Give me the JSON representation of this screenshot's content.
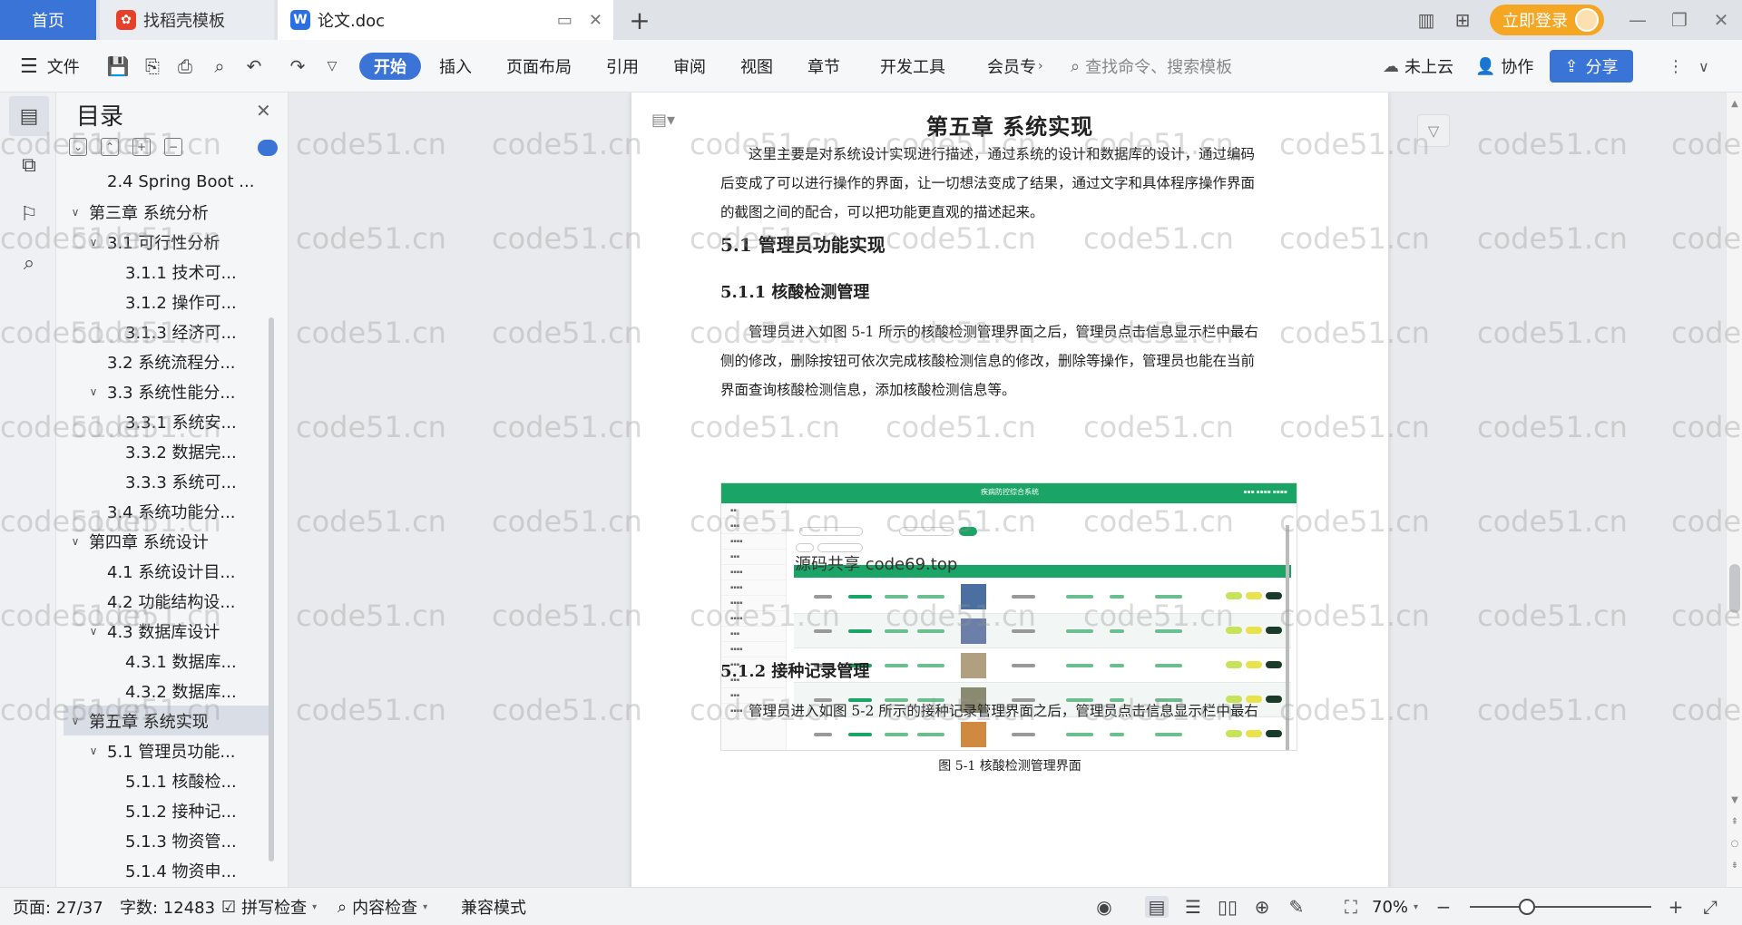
{
  "tabs": {
    "home": "首页",
    "template": "找稻壳模板",
    "document": "论文.doc",
    "add": "+"
  },
  "top_right": {
    "login": "立即登录",
    "window": {
      "minimize": "—",
      "maximize": "❐",
      "close": "✕"
    }
  },
  "toolbar": {
    "file_menu": "文件",
    "tabs": [
      "开始",
      "插入",
      "页面布局",
      "引用",
      "审阅",
      "视图",
      "章节",
      "开发工具",
      "会员专"
    ],
    "search_placeholder": "查找命令、搜索模板",
    "cloud": "未上云",
    "collab": "协作",
    "share": "分享"
  },
  "outline": {
    "title": "目录",
    "items": [
      {
        "label": "2.4 Spring Boot ...",
        "level": 2,
        "arrow": ""
      },
      {
        "label": "第三章  系统分析",
        "level": 1,
        "arrow": "v"
      },
      {
        "label": "3.1 可行性分析",
        "level": 2,
        "arrow": "v"
      },
      {
        "label": "3.1.1 技术可...",
        "level": 3,
        "arrow": ""
      },
      {
        "label": "3.1.2 操作可...",
        "level": 3,
        "arrow": ""
      },
      {
        "label": "3.1.3 经济可...",
        "level": 3,
        "arrow": ""
      },
      {
        "label": "3.2 系统流程分...",
        "level": 2,
        "arrow": ""
      },
      {
        "label": "3.3 系统性能分...",
        "level": 2,
        "arrow": "v"
      },
      {
        "label": "3.3.1 系统安...",
        "level": 3,
        "arrow": ""
      },
      {
        "label": "3.3.2 数据完...",
        "level": 3,
        "arrow": ""
      },
      {
        "label": "3.3.3 系统可...",
        "level": 3,
        "arrow": ""
      },
      {
        "label": "3.4 系统功能分...",
        "level": 2,
        "arrow": ""
      },
      {
        "label": "第四章  系统设计",
        "level": 1,
        "arrow": "v"
      },
      {
        "label": "4.1  系统设计目...",
        "level": 2,
        "arrow": ""
      },
      {
        "label": "4.2 功能结构设...",
        "level": 2,
        "arrow": ""
      },
      {
        "label": "4.3 数据库设计",
        "level": 2,
        "arrow": "v"
      },
      {
        "label": "4.3.1  数据库...",
        "level": 3,
        "arrow": ""
      },
      {
        "label": "4.3.2  数据库...",
        "level": 3,
        "arrow": ""
      },
      {
        "label": "第五章  系统实现",
        "level": 1,
        "arrow": "v",
        "selected": true
      },
      {
        "label": "5.1 管理员功能...",
        "level": 2,
        "arrow": "v"
      },
      {
        "label": "5.1.1  核酸检...",
        "level": 3,
        "arrow": ""
      },
      {
        "label": "5.1.2  接种记...",
        "level": 3,
        "arrow": ""
      },
      {
        "label": "5.1.3  物资管...",
        "level": 3,
        "arrow": ""
      },
      {
        "label": "5.1.4  物资申...",
        "level": 3,
        "arrow": ""
      }
    ]
  },
  "document": {
    "chapter_title": "第五章  系统实现",
    "intro_lines": [
      "这里主要是对系统设计实现进行描述，通过系统的设计和数据库的设计，通过编码",
      "后变成了可以进行操作的界面，让一切想法变成了结果，通过文字和具体程序操作界面",
      "的截图之间的配合，可以把功能更直观的描述起来。"
    ],
    "section_5_1": "5.1 管理员功能实现",
    "section_5_1_1": "5.1.1  核酸检测管理",
    "para_5_1_1": [
      "管理员进入如图 5-1 所示的核酸检测管理界面之后，管理员点击信息显示栏中最右",
      "侧的修改，删除按钮可依次完成核酸检测信息的修改，删除等操作，管理员也能在当前",
      "界面查询核酸检测信息，添加核酸检测信息等。"
    ],
    "figure_overlay": "源码共享  code69.top",
    "figure_header_title": "疾病防控综合系统",
    "figure_caption": "图 5-1  核酸检测管理界面",
    "section_5_1_2": "5.1.2  接种记录管理",
    "para_5_1_2": "管理员进入如图 5-2 所示的接种记录管理界面之后，管理员点击信息显示栏中最右"
  },
  "watermark": "code51.cn",
  "status": {
    "page": "页面: 27/37",
    "words": "字数: 12483",
    "spell": "拼写检查",
    "content_check": "内容检查",
    "compat": "兼容模式",
    "zoom": "70%"
  },
  "colors": {
    "accent": "#3a74d6",
    "login": "#f5a623",
    "figure_green": "#1aa566"
  }
}
